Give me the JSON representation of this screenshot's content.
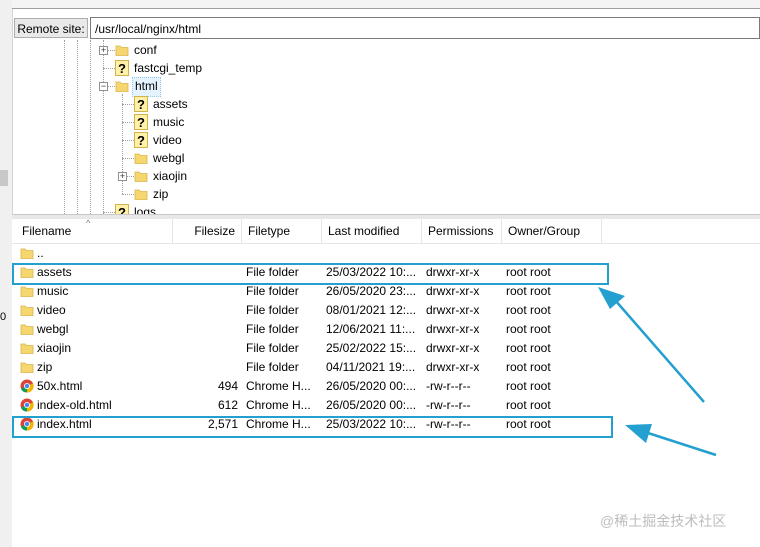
{
  "remote_site": {
    "label": "Remote site:",
    "path": "/usr/local/nginx/html"
  },
  "tree": [
    {
      "label": "conf",
      "icon": "folder-icon",
      "toggle": "+"
    },
    {
      "label": "fastcgi_temp",
      "icon": "unknown-folder-icon",
      "toggle": ""
    },
    {
      "label": "html",
      "icon": "folder-icon",
      "toggle": "−"
    },
    {
      "label": "assets",
      "icon": "unknown-folder-icon",
      "toggle": ""
    },
    {
      "label": "music",
      "icon": "unknown-folder-icon",
      "toggle": ""
    },
    {
      "label": "video",
      "icon": "unknown-folder-icon",
      "toggle": ""
    },
    {
      "label": "webgl",
      "icon": "folder-icon",
      "toggle": ""
    },
    {
      "label": "xiaojin",
      "icon": "folder-icon",
      "toggle": "+"
    },
    {
      "label": "zip",
      "icon": "folder-icon",
      "toggle": ""
    },
    {
      "label": "logs",
      "icon": "unknown-folder-icon",
      "toggle": ""
    }
  ],
  "columns": [
    "Filename",
    "Filesize",
    "Filetype",
    "Last modified",
    "Permissions",
    "Owner/Group"
  ],
  "files": [
    {
      "name": "..",
      "size": "",
      "type": "",
      "modified": "",
      "perms": "",
      "owner": "",
      "icon": "folder-icon"
    },
    {
      "name": "assets",
      "size": "",
      "type": "File folder",
      "modified": "25/03/2022 10:...",
      "perms": "drwxr-xr-x",
      "owner": "root root",
      "icon": "folder-icon"
    },
    {
      "name": "music",
      "size": "",
      "type": "File folder",
      "modified": "26/05/2020 23:...",
      "perms": "drwxr-xr-x",
      "owner": "root root",
      "icon": "folder-icon"
    },
    {
      "name": "video",
      "size": "",
      "type": "File folder",
      "modified": "08/01/2021 12:...",
      "perms": "drwxr-xr-x",
      "owner": "root root",
      "icon": "folder-icon"
    },
    {
      "name": "webgl",
      "size": "",
      "type": "File folder",
      "modified": "12/06/2021 11:...",
      "perms": "drwxr-xr-x",
      "owner": "root root",
      "icon": "folder-icon"
    },
    {
      "name": "xiaojin",
      "size": "",
      "type": "File folder",
      "modified": "25/02/2022 15:...",
      "perms": "drwxr-xr-x",
      "owner": "root root",
      "icon": "folder-icon"
    },
    {
      "name": "zip",
      "size": "",
      "type": "File folder",
      "modified": "04/11/2021 19:...",
      "perms": "drwxr-xr-x",
      "owner": "root root",
      "icon": "folder-icon"
    },
    {
      "name": "50x.html",
      "size": "494",
      "type": "Chrome H...",
      "modified": "26/05/2020 00:...",
      "perms": "-rw-r--r--",
      "owner": "root root",
      "icon": "chrome-icon"
    },
    {
      "name": "index-old.html",
      "size": "612",
      "type": "Chrome H...",
      "modified": "26/05/2020 00:...",
      "perms": "-rw-r--r--",
      "owner": "root root",
      "icon": "chrome-icon"
    },
    {
      "name": "index.html",
      "size": "2,571",
      "type": "Chrome H...",
      "modified": "25/03/2022 10:...",
      "perms": "-rw-r--r--",
      "owner": "root root",
      "icon": "chrome-icon"
    }
  ],
  "left_panel": {
    "fragment": "0"
  },
  "watermark": "@稀土掘金技术社区",
  "colors": {
    "annotation": "#24a0d0",
    "folder": "#f6d66f",
    "selection": "#e5f3ff"
  }
}
